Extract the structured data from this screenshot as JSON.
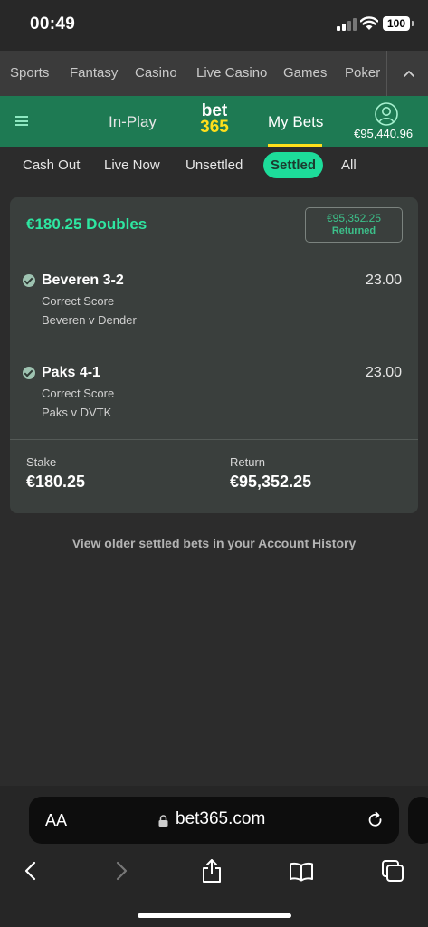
{
  "status_bar": {
    "time": "00:49",
    "battery": "100"
  },
  "top_nav": {
    "items": [
      "Sports",
      "Fantasy",
      "Casino",
      "Live Casino",
      "Games",
      "Poker"
    ]
  },
  "header": {
    "in_play": "In-Play",
    "logo_line1": "bet",
    "logo_line2": "365",
    "my_bets": "My Bets",
    "balance": "€95,440.96"
  },
  "subtabs": [
    "Cash Out",
    "Live Now",
    "Unsettled",
    "Settled",
    "All"
  ],
  "bet": {
    "title": "€180.25 Doubles",
    "returned_amount": "€95,352.25",
    "returned_label": "Returned",
    "selections": [
      {
        "name": "Beveren 3-2",
        "odds": "23.00",
        "market": "Correct Score",
        "fixture": "Beveren v Dender"
      },
      {
        "name": "Paks 4-1",
        "odds": "23.00",
        "market": "Correct Score",
        "fixture": "Paks v DVTK"
      }
    ],
    "stake_label": "Stake",
    "stake_value": "€180.25",
    "return_label": "Return",
    "return_value": "€95,352.25"
  },
  "history_link": "View older settled bets in your Account History",
  "browser": {
    "text_size": "AA",
    "url": "bet365.com"
  },
  "colors": {
    "brand_green": "#1e7a53",
    "accent_mint": "#1ddc9a",
    "logo_yellow": "#ffdf1b"
  }
}
